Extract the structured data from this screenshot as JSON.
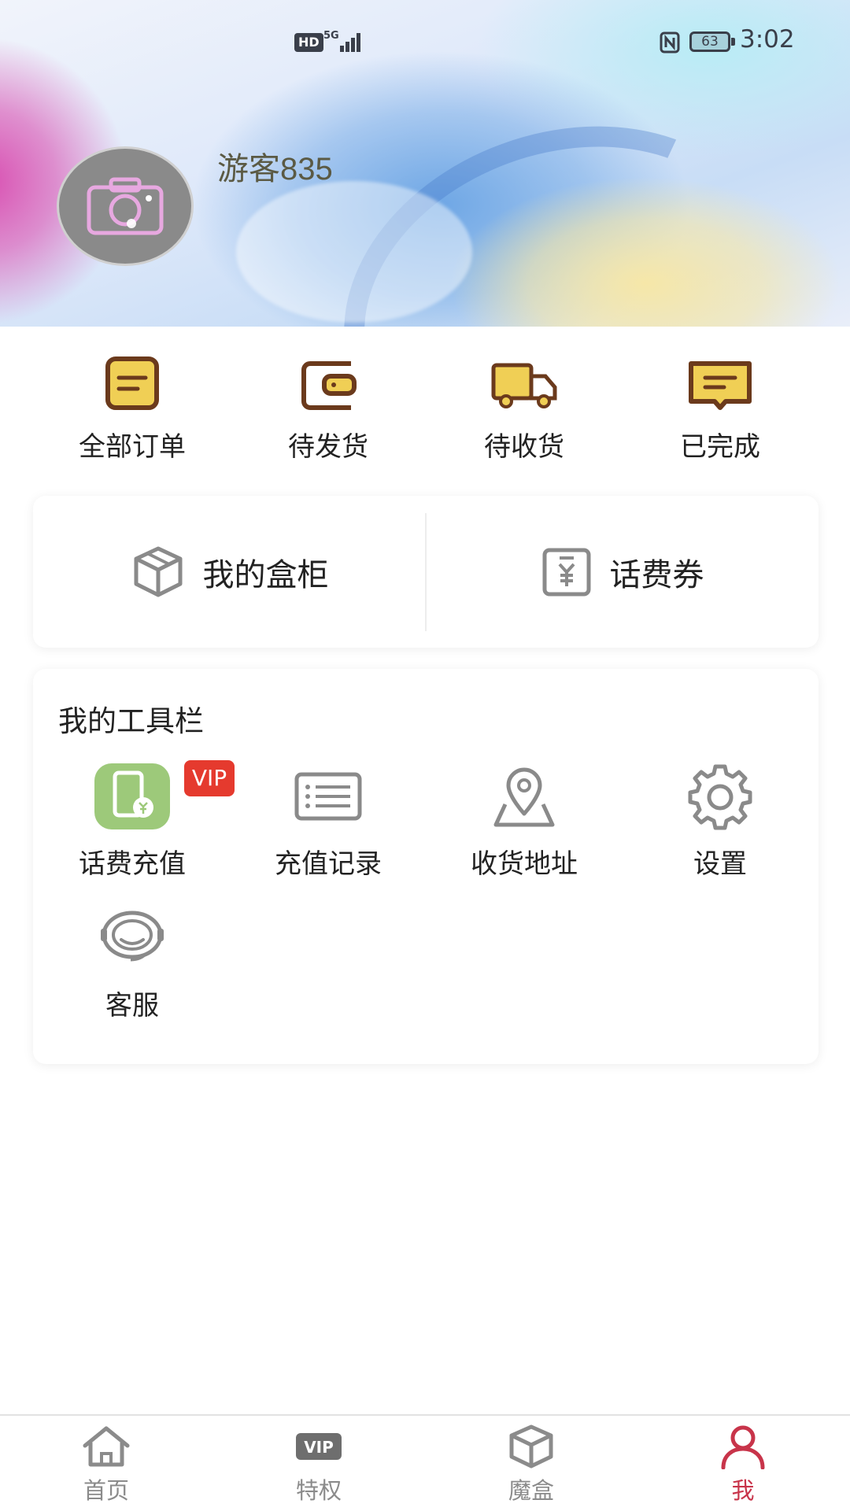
{
  "status_bar": {
    "hd": "HD",
    "network": "5G",
    "battery": "63",
    "time": "3:02"
  },
  "profile": {
    "username": "游客835"
  },
  "orders": [
    {
      "label": "全部订单",
      "icon": "order-list-icon"
    },
    {
      "label": "待发货",
      "icon": "wallet-icon"
    },
    {
      "label": "待收货",
      "icon": "truck-icon"
    },
    {
      "label": "已完成",
      "icon": "message-done-icon"
    }
  ],
  "shortcuts": [
    {
      "label": "我的盒柜",
      "icon": "box-icon"
    },
    {
      "label": "话费券",
      "icon": "coupon-icon"
    }
  ],
  "toolbar": {
    "title": "我的工具栏",
    "vip_badge": "VIP",
    "items": [
      {
        "label": "话费充值",
        "icon": "phone-recharge-icon"
      },
      {
        "label": "充值记录",
        "icon": "record-list-icon"
      },
      {
        "label": "收货地址",
        "icon": "location-icon"
      },
      {
        "label": "设置",
        "icon": "gear-icon"
      },
      {
        "label": "客服",
        "icon": "headset-icon"
      }
    ]
  },
  "bottom_nav": {
    "items": [
      {
        "label": "首页",
        "icon": "home-icon",
        "active": false
      },
      {
        "label": "特权",
        "icon": "vip-icon",
        "active": false
      },
      {
        "label": "魔盒",
        "icon": "box-icon",
        "active": false
      },
      {
        "label": "我",
        "icon": "person-icon",
        "active": true
      }
    ]
  },
  "colors": {
    "accent": "#c8344a",
    "vip": "#e53a2e",
    "order_icon_fill": "#f0cf55",
    "order_icon_stroke": "#6b3a1c",
    "recharge_green": "#9dc97a"
  }
}
